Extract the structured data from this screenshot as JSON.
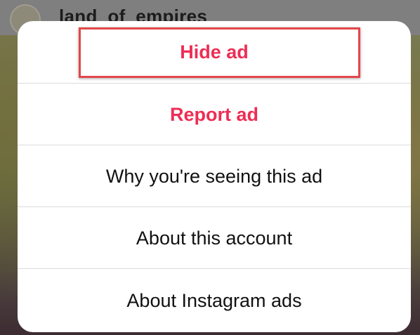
{
  "background": {
    "username": "land_of_empires"
  },
  "sheet": {
    "items": [
      {
        "label": "Hide ad",
        "style": "danger"
      },
      {
        "label": "Report ad",
        "style": "danger"
      },
      {
        "label": "Why you're seeing this ad",
        "style": "normal"
      },
      {
        "label": "About this account",
        "style": "normal"
      },
      {
        "label": "About Instagram ads",
        "style": "normal"
      }
    ]
  },
  "colors": {
    "danger": "#ed2e55",
    "text": "#111111",
    "highlight": "#e2474a",
    "divider": "#dbdbdb"
  }
}
